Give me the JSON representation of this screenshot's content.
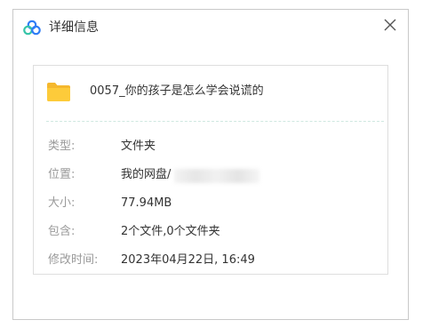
{
  "dialog": {
    "title": "详细信息",
    "close_label": "✕"
  },
  "file": {
    "name": "0057_你的孩子是怎么学会说谎的"
  },
  "properties": [
    {
      "label": "类型:",
      "value": "文件夹"
    },
    {
      "label": "位置:",
      "value": "我的网盘/"
    },
    {
      "label": "大小:",
      "value": "77.94MB"
    },
    {
      "label": "包含:",
      "value": "2个文件,0个文件夹"
    },
    {
      "label": "修改时间:",
      "value": "2023年04月22日, 16:49"
    }
  ],
  "icons": {
    "logo": "cloud-logo-icon",
    "folder": "folder-icon",
    "close": "close-icon"
  },
  "colors": {
    "folder": "#FDCB3A",
    "logo_blue": "#2E7CF6",
    "logo_green": "#36C4A8",
    "label": "#9A9A9A",
    "text": "#333333"
  }
}
